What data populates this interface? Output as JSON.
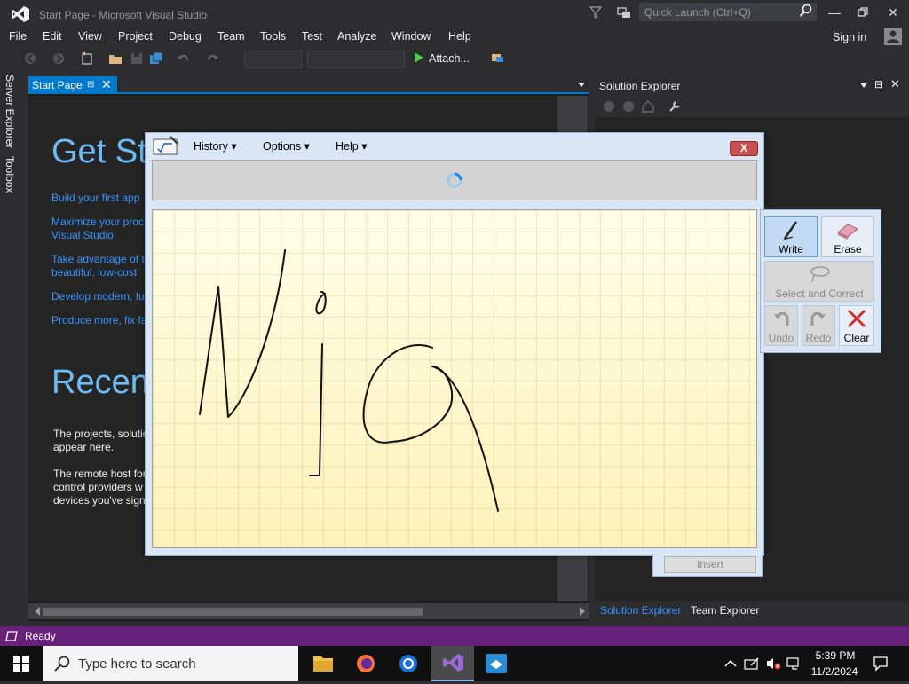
{
  "window": {
    "title": "Start Page - Microsoft Visual Studio"
  },
  "quick_launch": {
    "placeholder": "Quick Launch (Ctrl+Q)"
  },
  "menu": [
    "File",
    "Edit",
    "View",
    "Project",
    "Debug",
    "Team",
    "Tools",
    "Test",
    "Analyze",
    "Window",
    "Help"
  ],
  "signin": "Sign in",
  "toolbar": {
    "attach_label": "Attach..."
  },
  "side_tabs": [
    "Server Explorer",
    "Toolbox"
  ],
  "doc_tab": {
    "label": "Start Page"
  },
  "start_page": {
    "heading_get": "Get St",
    "links": [
      "Build your first app",
      "Maximize your proc",
      "Visual Studio",
      "Take advantage of th",
      "beautiful, low-cost",
      "Develop modern, fu",
      "Produce more, fix fa"
    ],
    "heading_recent": "Recent",
    "text": [
      "The projects, solutio",
      "appear here.",
      "The remote host for",
      "control providers w",
      "devices you've sign"
    ]
  },
  "solution_explorer": {
    "title": "Solution Explorer",
    "tabs": [
      "Solution Explorer",
      "Team Explorer"
    ]
  },
  "status": {
    "text": "Ready"
  },
  "taskbar": {
    "search_placeholder": "Type here to search",
    "time": "5:39 PM",
    "date": "11/2/2024"
  },
  "math_input": {
    "menus": [
      "History",
      "Options",
      "Help"
    ],
    "tools": {
      "write": "Write",
      "erase": "Erase",
      "select": "Select and Correct",
      "undo": "Undo",
      "redo": "Redo",
      "clear": "Clear"
    },
    "insert": "Insert",
    "close": "X"
  },
  "colors": {
    "accent": "#007acc",
    "status_bar": "#68217a",
    "link": "#3794ff"
  }
}
